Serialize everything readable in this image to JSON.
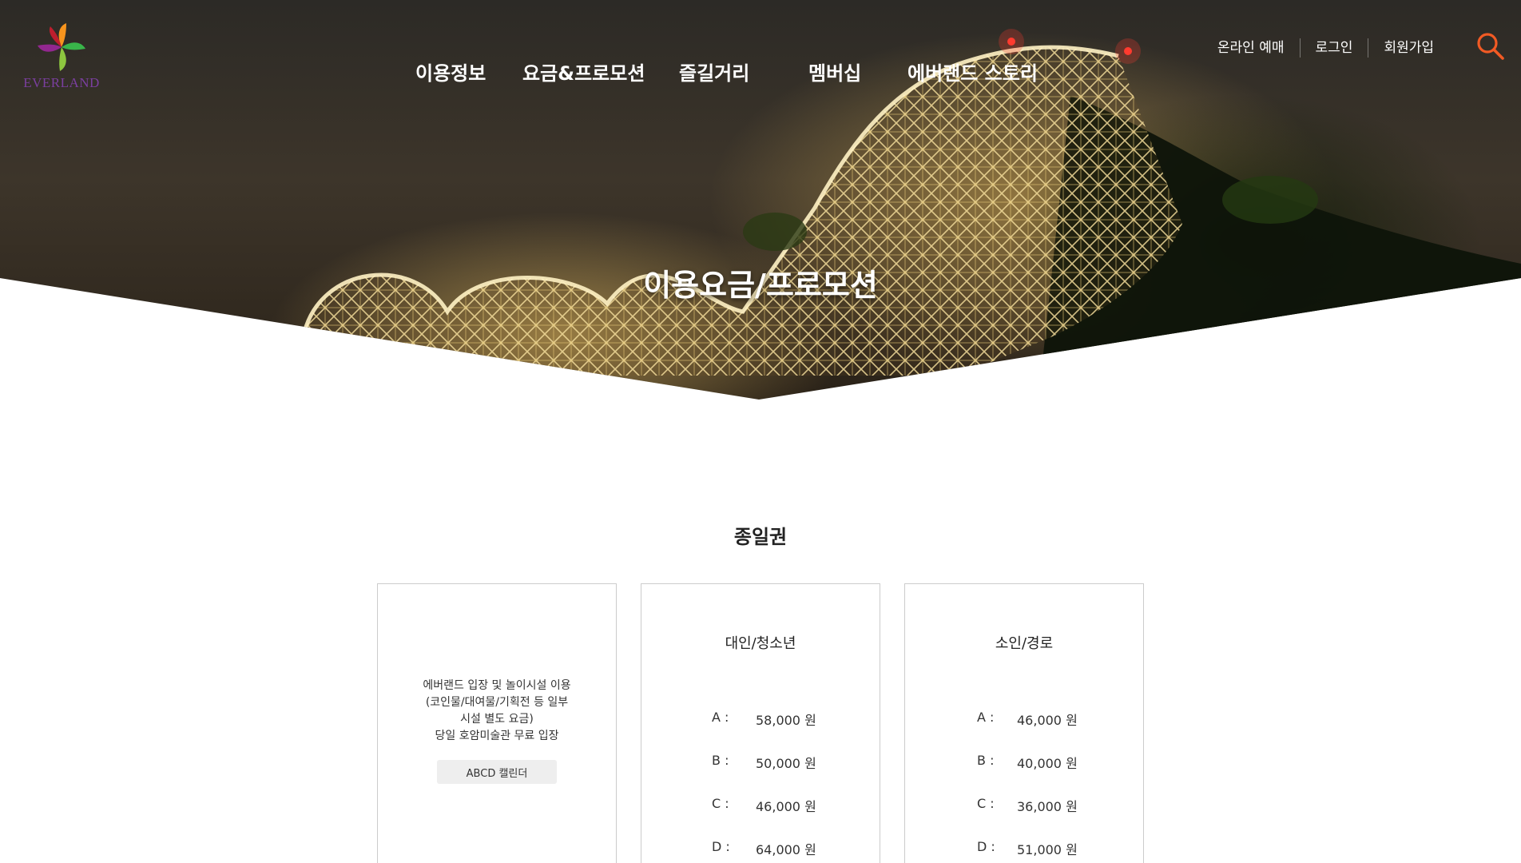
{
  "brand": {
    "logo_text": "EVERLAND"
  },
  "nav": {
    "items": [
      {
        "label": "이용정보"
      },
      {
        "label": "요금&프로모션"
      },
      {
        "label": "즐길거리"
      },
      {
        "label": "멤버십"
      },
      {
        "label": "에버랜드 스토리"
      }
    ]
  },
  "util": {
    "links": [
      {
        "label": "온라인 예매"
      },
      {
        "label": "로그인"
      },
      {
        "label": "회원가입"
      }
    ],
    "search_icon": "search-icon",
    "search_color": "#f15a24"
  },
  "hero": {
    "title": "이용요금/프로모션"
  },
  "section": {
    "title": "종일권"
  },
  "cards": {
    "info": {
      "description_lines": [
        "에버랜드 입장 및 놀이시설 이용",
        "(코인물/대여물/기획전 등 일부",
        "시설 별도 요금)",
        "당일 호암미술관 무료 입장"
      ],
      "calendar_button": "ABCD 캘린더"
    },
    "adult": {
      "title": "대인/청소년",
      "prices": [
        {
          "grade": "A :",
          "amount": "58,000 원"
        },
        {
          "grade": "B :",
          "amount": "50,000 원"
        },
        {
          "grade": "C :",
          "amount": "46,000 원"
        },
        {
          "grade": "D :",
          "amount": "64,000 원"
        }
      ]
    },
    "child": {
      "title": "소인/경로",
      "prices": [
        {
          "grade": "A :",
          "amount": "46,000 원"
        },
        {
          "grade": "B :",
          "amount": "40,000 원"
        },
        {
          "grade": "C :",
          "amount": "36,000 원"
        },
        {
          "grade": "D :",
          "amount": "51,000 원"
        }
      ]
    }
  }
}
